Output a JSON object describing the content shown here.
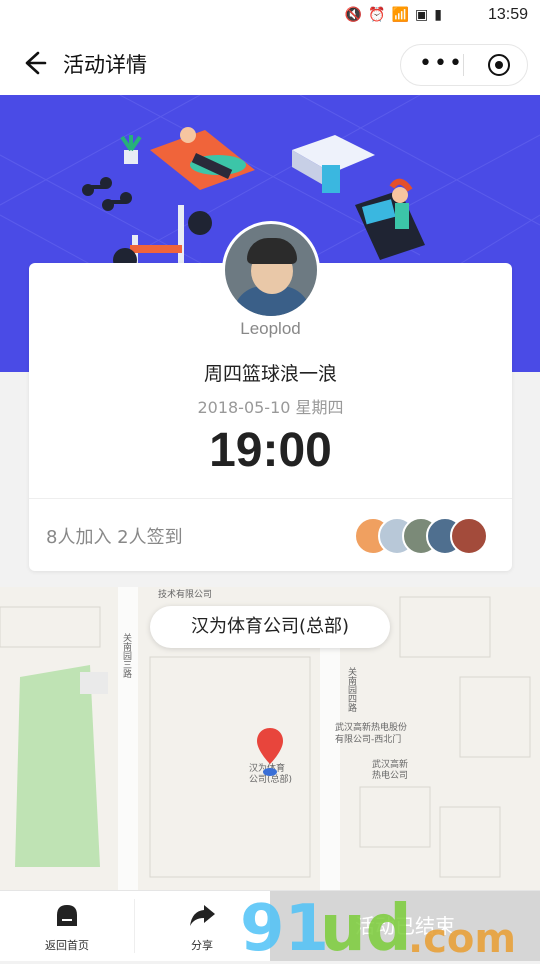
{
  "status_bar": {
    "time": "13:59"
  },
  "nav": {
    "title": "活动详情"
  },
  "card": {
    "username": "Leoplod",
    "event_title": "周四篮球浪一浪",
    "date": "2018-05-10 星期四",
    "time": "19:00",
    "stats": "8人加入 2人签到"
  },
  "map": {
    "place_name": "汉为体育公司(总部)",
    "labels": {
      "company_top": "技术有限公司",
      "road_left": "关南园三路",
      "road_right": "关南园四路",
      "electric_1": "武汉高新热电股份",
      "electric_2": "有限公司-西北门",
      "electric_3": "武汉高新",
      "electric_4": "热电公司",
      "poi_1": "汉为体育",
      "poi_2": "公司(总部)"
    }
  },
  "bottom": {
    "home_label": "返回首页",
    "share_label": "分享",
    "status_label": "活动已结束"
  },
  "watermark": {
    "logo": "91ud.com"
  },
  "colors": {
    "banner": "#4a4be6",
    "pin": "#e8453c",
    "ended_button": "#d6d6d6"
  }
}
